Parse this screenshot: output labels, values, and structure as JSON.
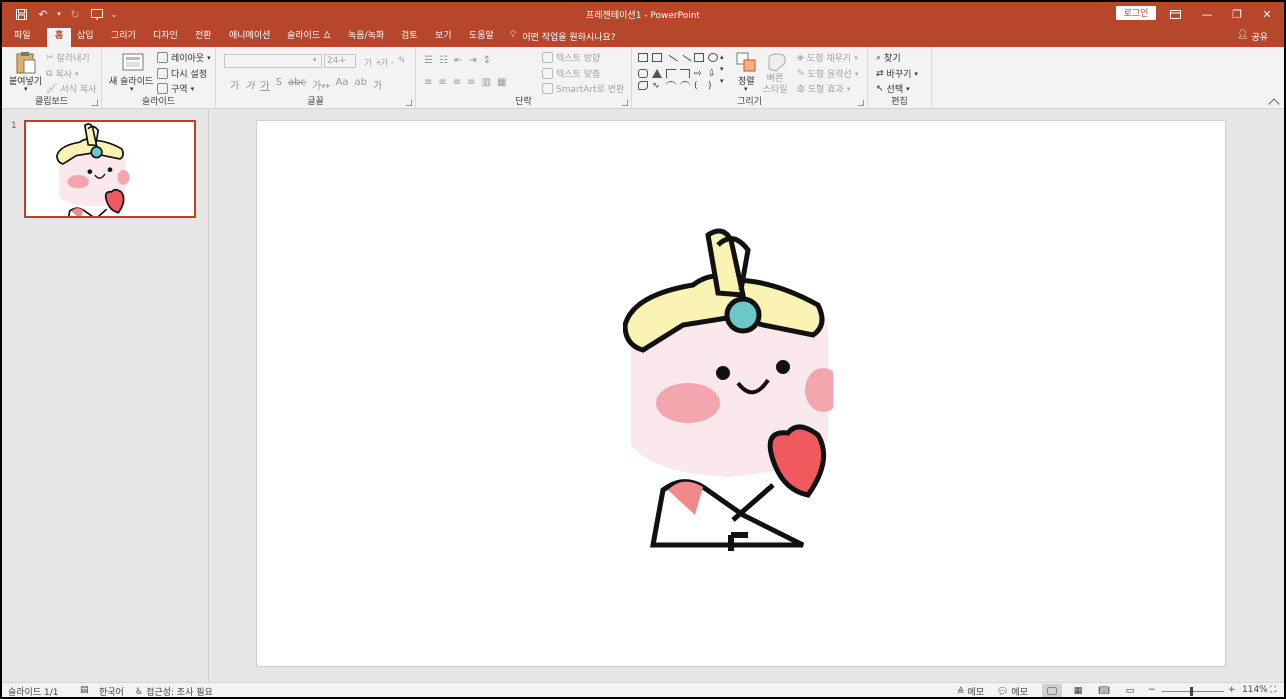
{
  "app": {
    "document_title": "프레젠테이션1  -  PowerPoint",
    "login_label": "로그인",
    "accent": "#b7472a"
  },
  "tabs": [
    "파일",
    "홈",
    "삽입",
    "그리기",
    "디자인",
    "전환",
    "애니메이션",
    "슬라이드 쇼",
    "녹음/녹화",
    "검토",
    "보기",
    "도움말"
  ],
  "tell_me": "어떤 작업을 원하시나요?",
  "share_label": "공유",
  "ribbon": {
    "clipboard": {
      "label": "클립보드",
      "paste": "붙여넣기",
      "cut": "잘라내기",
      "copy": "복사",
      "format_painter": "서식 복사"
    },
    "slides": {
      "label": "슬라이드",
      "new_slide": "새 슬라이드",
      "layout": "레이아웃",
      "reset": "다시 설정",
      "section": "구역"
    },
    "font": {
      "label": "글꼴",
      "size": "24+"
    },
    "paragraph": {
      "label": "단락",
      "text_direction": "텍스트 방향",
      "align_text": "텍스트 맞춤",
      "smartart": "SmartArt로 변환"
    },
    "drawing": {
      "label": "그리기",
      "arrange": "정렬",
      "quick_styles": "빠른 스타일",
      "shape_fill": "도형 채우기",
      "shape_outline": "도형 윤곽선",
      "shape_effects": "도형 효과"
    },
    "editing": {
      "label": "편집",
      "find": "찾기",
      "replace": "바꾸기",
      "select": "선택"
    }
  },
  "thumbnails": [
    {
      "number": "1"
    }
  ],
  "status": {
    "slide_info": "슬라이드 1/1",
    "language": "한국어",
    "accessibility": "접근성: 조사 필요",
    "notes": "메모",
    "comments": "메모",
    "zoom": "114%"
  }
}
